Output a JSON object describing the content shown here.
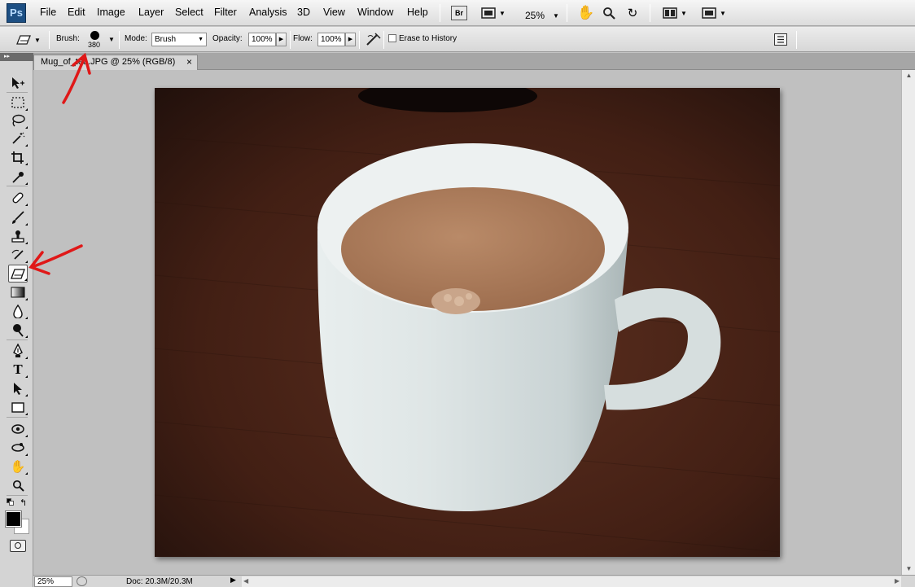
{
  "app": {
    "logo": "Ps",
    "menu": [
      "File",
      "Edit",
      "Image",
      "Layer",
      "Select",
      "Filter",
      "Analysis",
      "3D",
      "View",
      "Window",
      "Help"
    ],
    "bridge_label": "Br",
    "zoom_level": "25%"
  },
  "options_bar": {
    "brush_label": "Brush:",
    "brush_size": "380",
    "mode_label": "Mode:",
    "mode_value": "Brush",
    "opacity_label": "Opacity:",
    "opacity_value": "100%",
    "flow_label": "Flow:",
    "flow_value": "100%",
    "erase_to_history_label": "Erase to History",
    "erase_to_history_checked": false
  },
  "document": {
    "tab_title": "Mug_of_tea.JPG @ 25% (RGB/8)",
    "image_subject": "coffee-mug-photo"
  },
  "tools": {
    "selected": "eraser-tool",
    "foreground_color": "#000000",
    "background_color": "#ffffff"
  },
  "status_bar": {
    "zoom": "25%",
    "doc_info": "Doc: 20.3M/20.3M"
  },
  "colors": {
    "annotation": "#e01818",
    "logo_bg": "#1d4f83"
  }
}
